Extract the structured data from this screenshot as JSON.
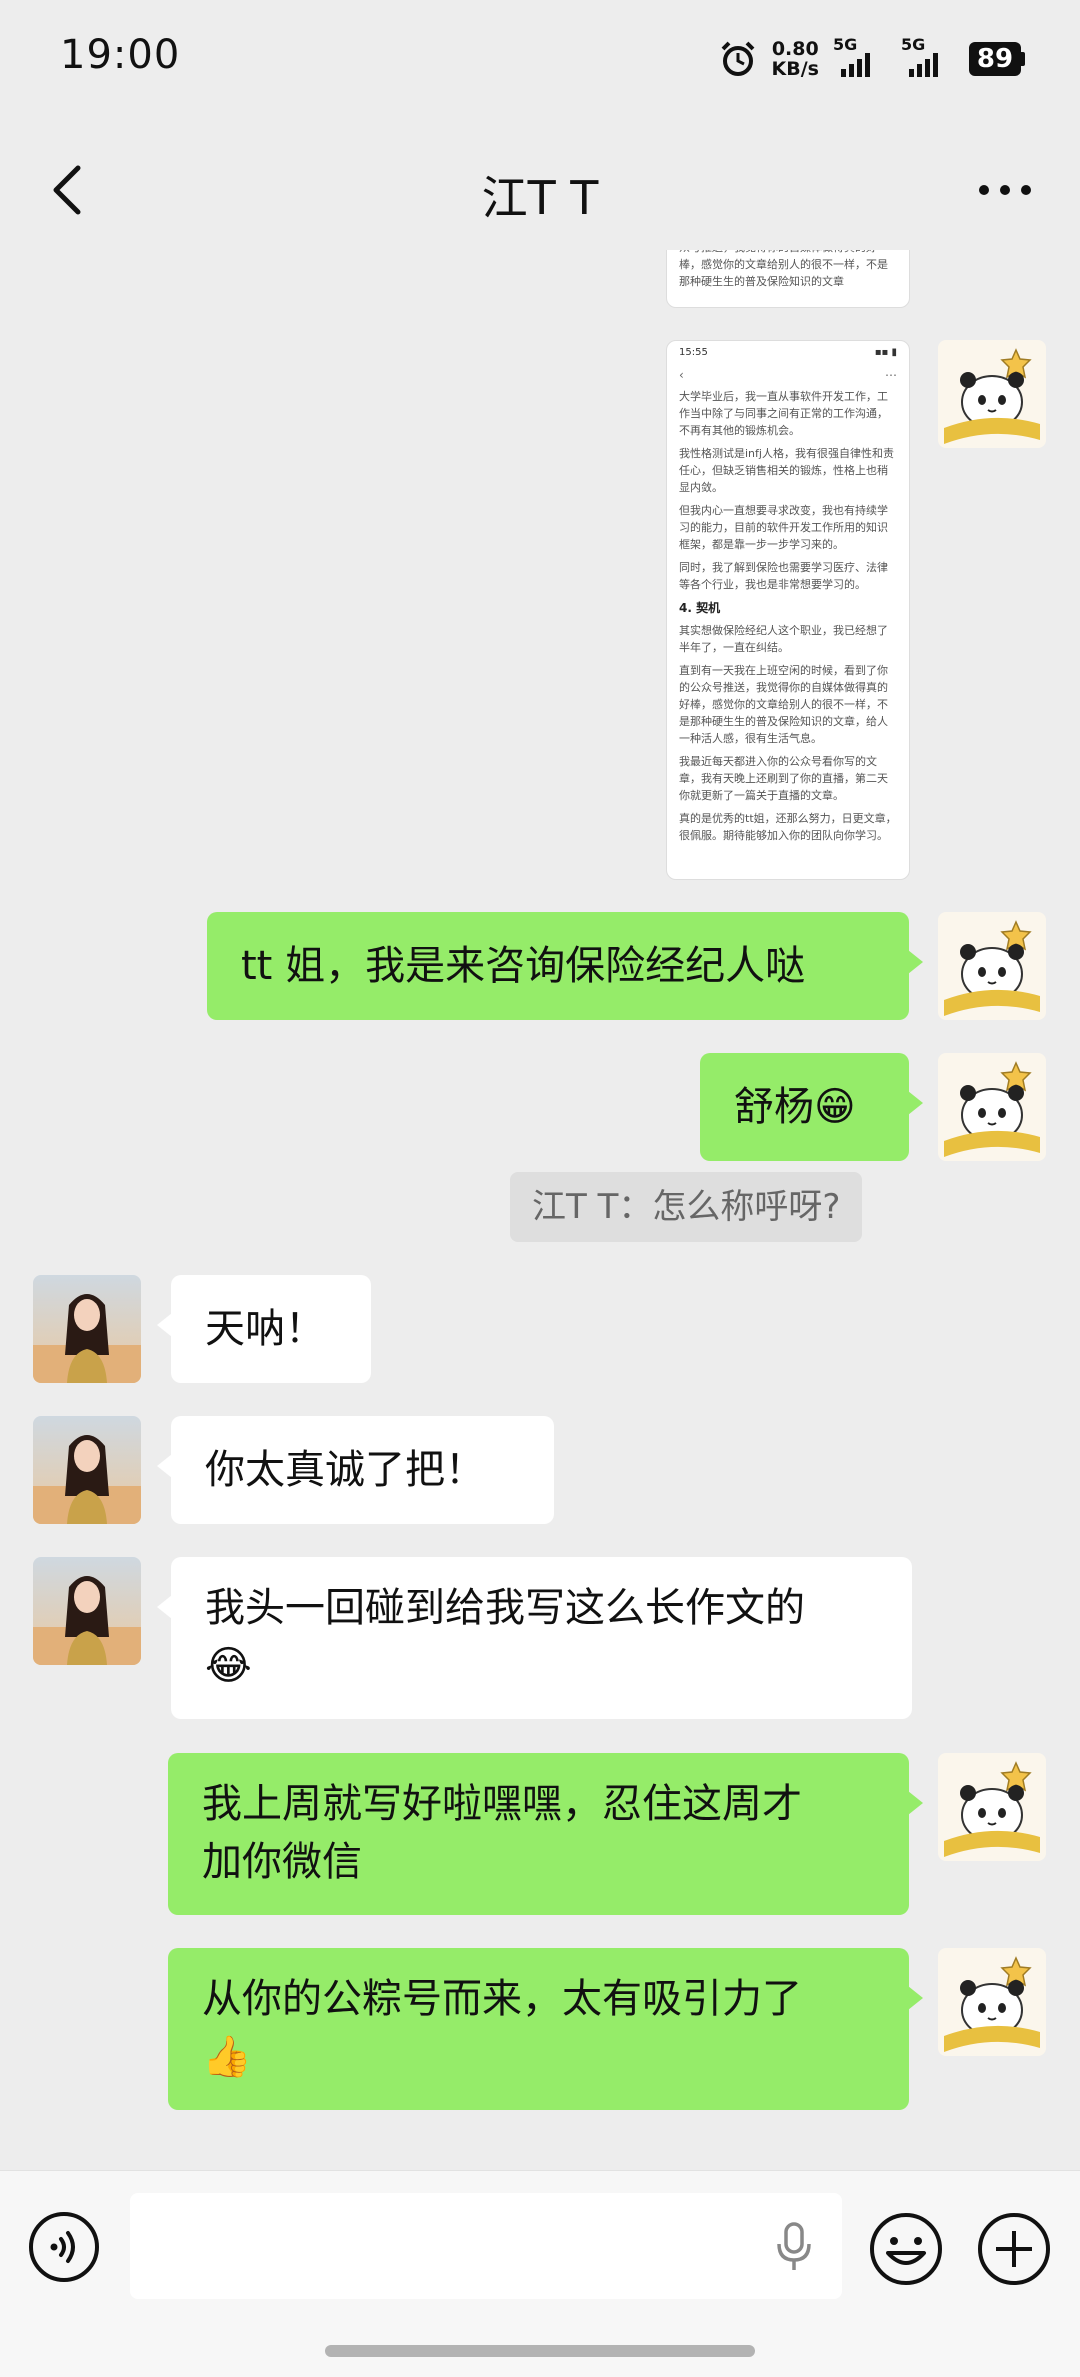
{
  "status": {
    "time": "19:00",
    "net_speed_value": "0.80",
    "net_speed_unit": "KB/s",
    "sig1": "5G",
    "sig2": "5G",
    "battery": "89"
  },
  "header": {
    "title": "江T T"
  },
  "shot": {
    "time": "15:55",
    "paragraphs": [
      "大学毕业后，我一直从事软件开发工作，工作当中除了与同事之间有正常的工作沟通，不再有其他的锻炼机会。",
      "我性格测试是infj人格，我有很强自律性和责任心，但缺乏销售相关的锻炼，性格上也稍显内敛。",
      "但我内心一直想要寻求改变，我也有持续学习的能力，目前的软件开发工作所用的知识框架，都是靠一步一步学习来的。",
      "同时，我了解到保险也需要学习医疗、法律等各个行业，我也是非常想要学习的。"
    ],
    "heading": "4. 契机",
    "paragraphs2": [
      "其实想做保险经纪人这个职业，我已经想了半年了，一直在纠结。",
      "直到有一天我在上班空闲的时候，看到了你的公众号推送，我觉得你的自媒体做得真的好棒，感觉你的文章给别人的很不一样，不是那种硬生生的普及保险知识的文章，给人一种活人感，很有生活气息。",
      "我最近每天都进入你的公众号看你写的文章，我有天晚上还刷到了你的直播，第二天你就更新了一篇关于直播的文章。",
      "真的是优秀的tt姐，还那么努力，日更文章，很佩服。期待能够加入你的团队向你学习。"
    ],
    "top_fragment": "众号推送，我觉得你的自媒体做得真的好棒，感觉你的文章给别人的很不一样，不是那种硬生生的普及保险知识的文章"
  },
  "messages": [
    {
      "text": "tt 姐，我是来咨询保险经纪人哒"
    },
    {
      "text": "舒杨😁"
    },
    {
      "text": "江T T：怎么称呼呀?"
    },
    {
      "text": "天呐！"
    },
    {
      "text": "你太真诚了把！"
    },
    {
      "line1": "我头一回碰到给我写这么长作文的",
      "line2": "😂"
    },
    {
      "line1": "我上周就写好啦嘿嘿，忍住这周才",
      "line2": "加你微信"
    },
    {
      "line1": "从你的公粽号而来，太有吸引力了",
      "line2": "👍"
    }
  ],
  "colors": {
    "bubble_green": "#95ec69",
    "bubble_white": "#ffffff",
    "background": "#ededed"
  },
  "icons": [
    "back-arrow-icon",
    "more-icon",
    "voice-icon",
    "mic-icon",
    "emoji-icon",
    "plus-icon"
  ]
}
